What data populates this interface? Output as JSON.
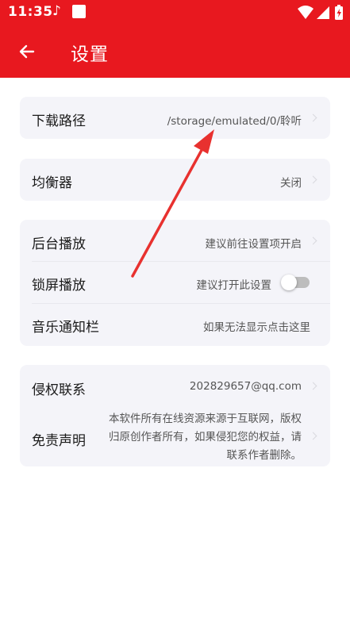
{
  "status_bar": {
    "time": "11:35",
    "music_glyph": "♪",
    "icons": [
      "music-note-icon",
      "app-square-icon",
      "wifi-icon",
      "signal-icon",
      "battery-charging-icon"
    ]
  },
  "app_bar": {
    "title": "设置",
    "back_icon": "arrow-left-icon"
  },
  "colors": {
    "accent": "#e8181f",
    "card_bg": "#f4f4f9",
    "annotation_arrow": "#e8312f"
  },
  "settings": {
    "download_path": {
      "label": "下载路径",
      "value": "/storage/emulated/0/聆听"
    },
    "equalizer": {
      "label": "均衡器",
      "value": "关闭"
    },
    "background_play": {
      "label": "后台播放",
      "value": "建议前往设置项开启"
    },
    "lockscreen_play": {
      "label": "锁屏播放",
      "value": "建议打开此设置",
      "enabled": false
    },
    "music_notification": {
      "label": "音乐通知栏",
      "value": "如果无法显示点击这里"
    },
    "infringement_contact": {
      "label": "侵权联系",
      "value": "202829657@qq.com"
    },
    "disclaimer": {
      "label": "免责声明",
      "value": "本软件所有在线资源来源于互联网，版权归原创作者所有，如果侵犯您的权益，请联系作者删除。"
    }
  }
}
